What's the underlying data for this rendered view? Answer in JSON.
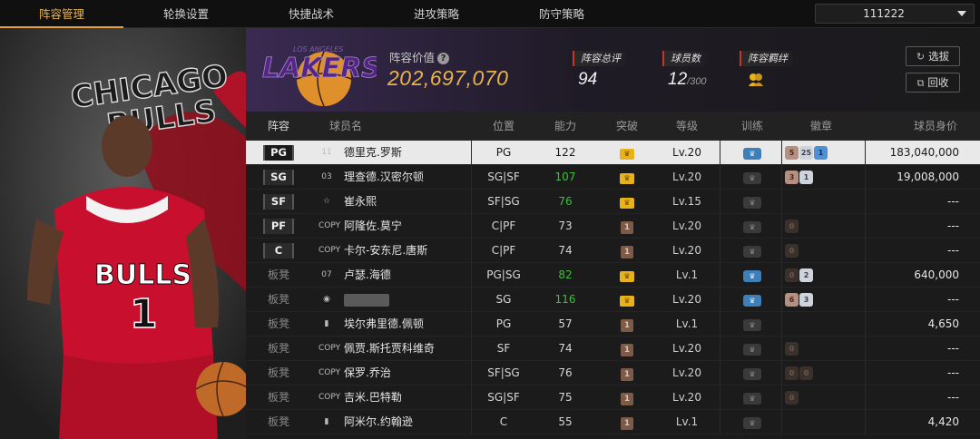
{
  "nav": {
    "tabs": [
      "阵容管理",
      "轮换设置",
      "快捷战术",
      "进攻策略",
      "防守策略"
    ],
    "active_tab": 0,
    "selector_value": "111222"
  },
  "art": {
    "team_text_1": "CHICAGO",
    "team_text_2": "BULLS",
    "jersey_text": "BULLS",
    "jersey_number": "1"
  },
  "header": {
    "logo_text": "LAKERS",
    "logo_subtext": "LOS ANGELES",
    "value_label": "阵容价值",
    "value": "202,697,070",
    "rating_label": "阵容总评",
    "rating": "94",
    "count_label": "球员数",
    "count": "12",
    "count_max": "/300",
    "bond_label": "阵容羁绊",
    "scout_label": "选拔",
    "recycle_label": "回收"
  },
  "table": {
    "headers": [
      "阵容",
      "球员名",
      "位置",
      "能力",
      "突破",
      "等级",
      "训练",
      "徽章",
      "球员身价"
    ],
    "rows": [
      {
        "slot": "PG",
        "starter": true,
        "num": "11",
        "name": "德里克.罗斯",
        "pos": "PG",
        "ability": "122",
        "green": false,
        "break": "crown",
        "level": "Lv.20",
        "train": "on",
        "badges": [
          [
            "bronze",
            "5"
          ],
          [
            "silver",
            "25"
          ],
          [
            "blue",
            "1"
          ]
        ],
        "price": "183,040,000",
        "selected": true
      },
      {
        "slot": "SG",
        "starter": true,
        "num": "03",
        "name": "理查德.汉密尔顿",
        "pos": "SG|SF",
        "ability": "107",
        "green": true,
        "break": "crown",
        "level": "Lv.20",
        "train": "off",
        "badges": [
          [
            "bronze",
            "3"
          ],
          [
            "silver",
            "1"
          ]
        ],
        "price": "19,008,000"
      },
      {
        "slot": "SF",
        "starter": true,
        "num": "☆",
        "name": "崔永熙",
        "pos": "SF|SG",
        "ability": "76",
        "green": true,
        "break": "crown",
        "level": "Lv.15",
        "train": "off",
        "badges": [],
        "price": "---"
      },
      {
        "slot": "PF",
        "starter": true,
        "num": "COPY",
        "name": "阿隆佐.莫宁",
        "pos": "C|PF",
        "ability": "73",
        "green": false,
        "break": "shield",
        "level": "Lv.20",
        "train": "off",
        "badges": [
          [
            "dark",
            "0"
          ]
        ],
        "price": "---"
      },
      {
        "slot": "C",
        "starter": true,
        "num": "COPY",
        "name": "卡尔-安东尼.唐斯",
        "pos": "C|PF",
        "ability": "74",
        "green": false,
        "break": "shield",
        "level": "Lv.20",
        "train": "off",
        "badges": [
          [
            "dark",
            "0"
          ]
        ],
        "price": "---"
      },
      {
        "slot": "板凳",
        "starter": false,
        "num": "07",
        "name": "卢瑟.海德",
        "pos": "PG|SG",
        "ability": "82",
        "green": true,
        "break": "crown",
        "level": "Lv.1",
        "train": "on",
        "badges": [
          [
            "dark",
            "0"
          ],
          [
            "silver",
            "2"
          ]
        ],
        "price": "640,000"
      },
      {
        "slot": "板凳",
        "starter": false,
        "num": "◉",
        "name": "",
        "pos": "SG",
        "ability": "116",
        "green": true,
        "break": "crown",
        "level": "Lv.20",
        "train": "on",
        "badges": [
          [
            "bronze",
            "6"
          ],
          [
            "silver",
            "3"
          ]
        ],
        "price": "---"
      },
      {
        "slot": "板凳",
        "starter": false,
        "num": "▮",
        "name": "埃尔弗里德.佩顿",
        "pos": "PG",
        "ability": "57",
        "green": false,
        "break": "shield",
        "level": "Lv.1",
        "train": "off",
        "badges": [],
        "price": "4,650"
      },
      {
        "slot": "板凳",
        "starter": false,
        "num": "COPY",
        "name": "佩贾.斯托贾科维奇",
        "pos": "SF",
        "ability": "74",
        "green": false,
        "break": "shield",
        "level": "Lv.20",
        "train": "off",
        "badges": [
          [
            "dark",
            "0"
          ]
        ],
        "price": "---"
      },
      {
        "slot": "板凳",
        "starter": false,
        "num": "COPY",
        "name": "保罗.乔治",
        "pos": "SF|SG",
        "ability": "76",
        "green": false,
        "break": "shield",
        "level": "Lv.20",
        "train": "off",
        "badges": [
          [
            "dark",
            "0"
          ],
          [
            "dark",
            "0"
          ]
        ],
        "price": "---"
      },
      {
        "slot": "板凳",
        "starter": false,
        "num": "COPY",
        "name": "吉米.巴特勒",
        "pos": "SG|SF",
        "ability": "75",
        "green": false,
        "break": "shield",
        "level": "Lv.20",
        "train": "off",
        "badges": [
          [
            "dark",
            "0"
          ]
        ],
        "price": "---"
      },
      {
        "slot": "板凳",
        "starter": false,
        "num": "▮",
        "name": "阿米尔.约翰逊",
        "pos": "C",
        "ability": "55",
        "green": false,
        "break": "shield",
        "level": "Lv.1",
        "train": "off",
        "badges": [],
        "price": "4,420"
      }
    ]
  },
  "colors": {
    "accent": "#e7a23a",
    "gold_value": "#e8b34c",
    "green_ability": "#3dbf3d",
    "stat_marker": "#c0392b",
    "lakers_purple": "#552583",
    "bulls_red": "#c8102e"
  }
}
